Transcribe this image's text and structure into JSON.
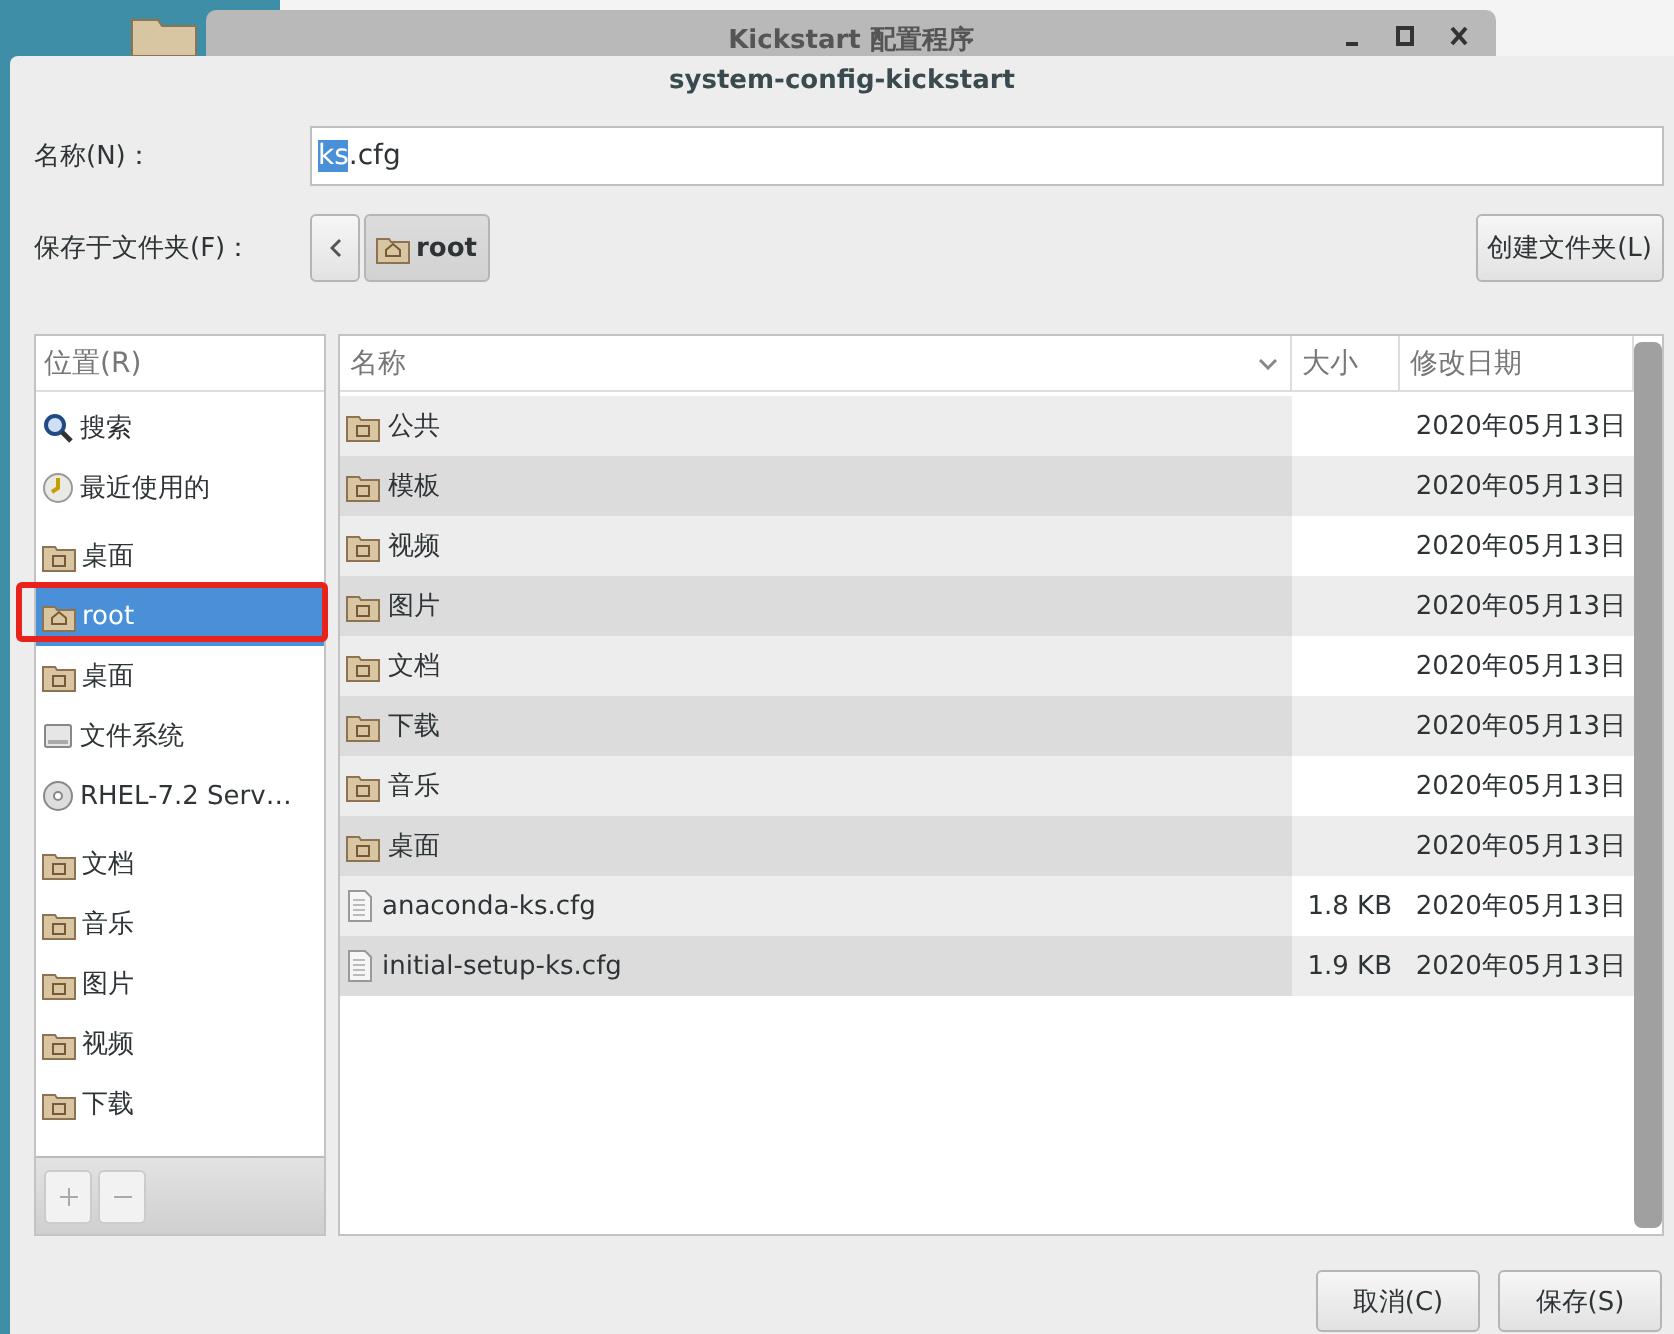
{
  "background_window": {
    "title": "Kickstart 配置程序"
  },
  "dialog": {
    "title": "system-config-kickstart",
    "name_label": "名称(N)：",
    "name_field": {
      "selected_text": "ks",
      "text": ".cfg"
    },
    "folder_label": "保存于文件夹(F)：",
    "path": [
      {
        "label": "root",
        "kind": "home",
        "selected": true
      }
    ],
    "create_folder_button": "创建文件夹(L)",
    "places_header": "位置(R)",
    "places": [
      {
        "label": "搜索",
        "kind": "search",
        "selected": false,
        "annotated": false
      },
      {
        "label": "最近使用的",
        "kind": "recent",
        "selected": false,
        "annotated": false
      },
      {
        "label": "桌面",
        "kind": "folder",
        "selected": false,
        "annotated": false
      },
      {
        "label": "root",
        "kind": "home",
        "selected": true,
        "annotated": true
      },
      {
        "label": "桌面",
        "kind": "folder",
        "selected": false,
        "annotated": false
      },
      {
        "label": "文件系统",
        "kind": "drive",
        "selected": false,
        "annotated": false
      },
      {
        "label": "RHEL-7.2 Serv…",
        "kind": "disc",
        "selected": false,
        "annotated": false
      },
      {
        "label": "文档",
        "kind": "folder",
        "selected": false,
        "annotated": false
      },
      {
        "label": "音乐",
        "kind": "folder",
        "selected": false,
        "annotated": false
      },
      {
        "label": "图片",
        "kind": "folder",
        "selected": false,
        "annotated": false
      },
      {
        "label": "视频",
        "kind": "folder",
        "selected": false,
        "annotated": false
      },
      {
        "label": "下载",
        "kind": "folder",
        "selected": false,
        "annotated": false
      }
    ],
    "columns": [
      {
        "label": "名称",
        "sorted": true
      },
      {
        "label": "大小",
        "sorted": false
      },
      {
        "label": "修改日期",
        "sorted": false
      }
    ],
    "files": [
      {
        "name": "公共",
        "kind": "folder",
        "modified": "2020年05月13日",
        "selected": false
      },
      {
        "name": "模板",
        "kind": "folder",
        "modified": "2020年05月13日",
        "selected": false
      },
      {
        "name": "视频",
        "kind": "folder",
        "modified": "2020年05月13日",
        "selected": false
      },
      {
        "name": "图片",
        "kind": "folder",
        "modified": "2020年05月13日",
        "selected": false
      },
      {
        "name": "文档",
        "kind": "folder",
        "modified": "2020年05月13日",
        "selected": false
      },
      {
        "name": "下载",
        "kind": "folder",
        "modified": "2020年05月13日",
        "selected": false
      },
      {
        "name": "音乐",
        "kind": "folder",
        "modified": "2020年05月13日",
        "selected": false
      },
      {
        "name": "桌面",
        "kind": "folder",
        "modified": "2020年05月13日",
        "selected": false
      },
      {
        "name": "anaconda-ks.cfg",
        "kind": "file",
        "size": "1.8 KB",
        "modified": "2020年05月13日",
        "selected": false
      },
      {
        "name": "initial-setup-ks.cfg",
        "kind": "file",
        "size": "1.9 KB",
        "modified": "2020年05月13日",
        "selected": false
      }
    ],
    "buttons": [
      "取消(C)",
      "保存(S)"
    ]
  }
}
